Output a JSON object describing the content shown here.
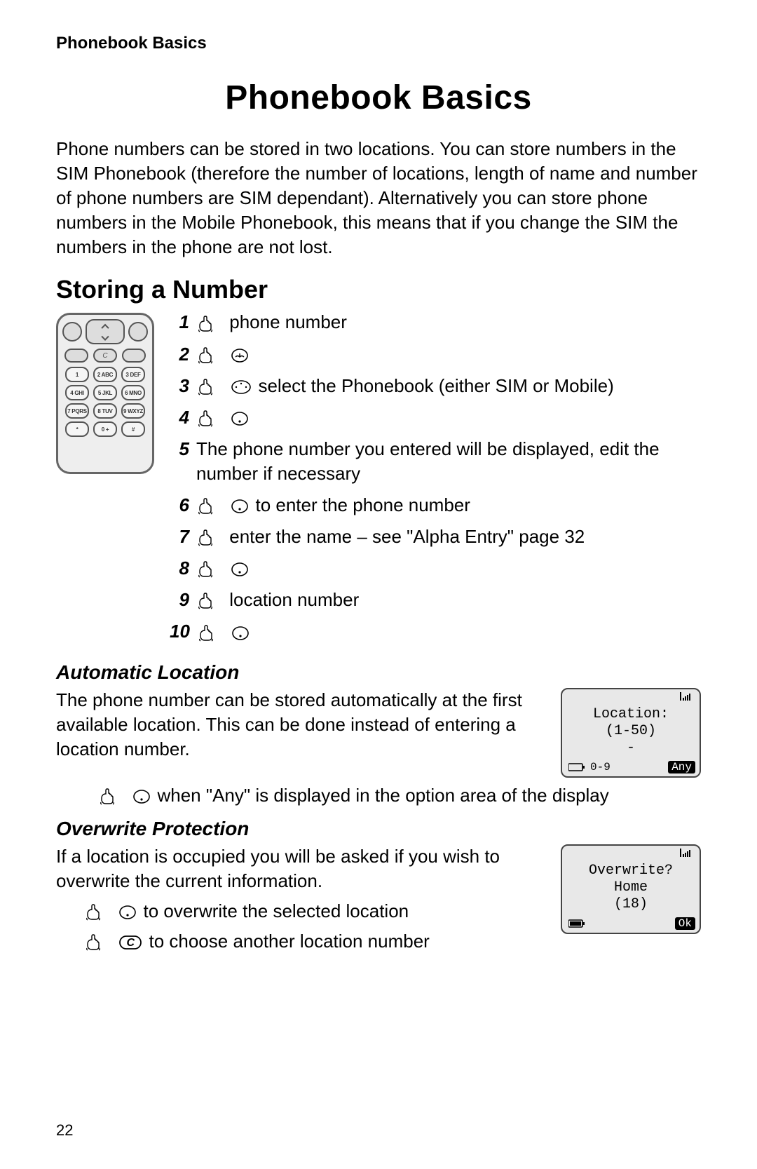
{
  "running_head": "Phonebook Basics",
  "title": "Phonebook Basics",
  "intro": "Phone numbers can be stored in two locations. You can store numbers in the SIM Phonebook (therefore the number of locations, length of name and number of phone numbers are SIM dependant). Alternatively you can store phone numbers in the Mobile Phonebook, this means that if you change the SIM the numbers in the phone are not lost.",
  "section_storing": "Storing a Number",
  "phone_keypad": {
    "mid": [
      "",
      "C",
      ""
    ],
    "keys": [
      "1",
      "2 ABC",
      "3 DEF",
      "4 GHI",
      "5 JKL",
      "6 MNO",
      "7 PQRS",
      "8 TUV",
      "9 WXYZ",
      "*",
      "0 +",
      "# "
    ]
  },
  "steps": [
    {
      "n": "1",
      "text_after": "phone number"
    },
    {
      "n": "2",
      "text_after": ""
    },
    {
      "n": "3",
      "text_after": "select the Phonebook (either SIM or Mobile)"
    },
    {
      "n": "4",
      "text_after": ""
    },
    {
      "n": "5",
      "no_hand": true,
      "text_after": "The phone number you entered will be displayed, edit the number if necessary"
    },
    {
      "n": "6",
      "text_after": "to enter the phone number"
    },
    {
      "n": "7",
      "text_after": "enter the name – see \"Alpha Entry\" page 32"
    },
    {
      "n": "8",
      "text_after": ""
    },
    {
      "n": "9",
      "text_after": "location number"
    },
    {
      "n": "10",
      "text_after": ""
    }
  ],
  "sub_auto": "Automatic Location",
  "auto_text": "The phone number can be stored automatically at the first available location. This can be done instead of entering a location number.",
  "auto_indent": "when \"Any\" is displayed in the option area of the display",
  "screen_location": {
    "line1": "Location:",
    "line2": "(1-50)",
    "line3": "-",
    "foot_left": "0-9",
    "foot_right": "Any"
  },
  "sub_over": "Overwrite Protection",
  "over_text": "If a location is occupied you will be asked if you wish to overwrite the current information.",
  "over_line1": "to overwrite the selected location",
  "over_line2_after": "to choose another location number",
  "c_key_label": "C",
  "screen_overwrite": {
    "line1": "Overwrite?",
    "line2": "Home",
    "line3": "(18)",
    "foot_right": "Ok"
  },
  "page_number": "22"
}
